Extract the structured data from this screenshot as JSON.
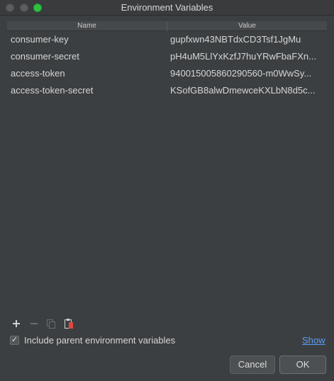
{
  "window": {
    "title": "Environment Variables"
  },
  "table": {
    "headers": {
      "name": "Name",
      "value": "Value"
    },
    "rows": [
      {
        "name": "consumer-key",
        "value": "gupfxwn43NBTdxCD3Tsf1JgMu"
      },
      {
        "name": "consumer-secret",
        "value": "pH4uM5LlYxKzfJ7huYRwFbaFXn..."
      },
      {
        "name": "access-token",
        "value": "940015005860290560-m0WwSy..."
      },
      {
        "name": "access-token-secret",
        "value": "KSofGB8alwDmewceKXLbN8d5c..."
      }
    ]
  },
  "toolbar": {
    "add_icon": "plus-icon",
    "remove_icon": "minus-icon",
    "copy_icon": "copy-icon",
    "paste_icon": "paste-icon"
  },
  "options": {
    "include_parent_label": "Include parent environment variables",
    "include_parent_checked": true,
    "show_link": "Show"
  },
  "buttons": {
    "cancel": "Cancel",
    "ok": "OK"
  },
  "colors": {
    "background": "#3c3f41",
    "link": "#589df6",
    "zoom_button": "#2dc13f"
  }
}
